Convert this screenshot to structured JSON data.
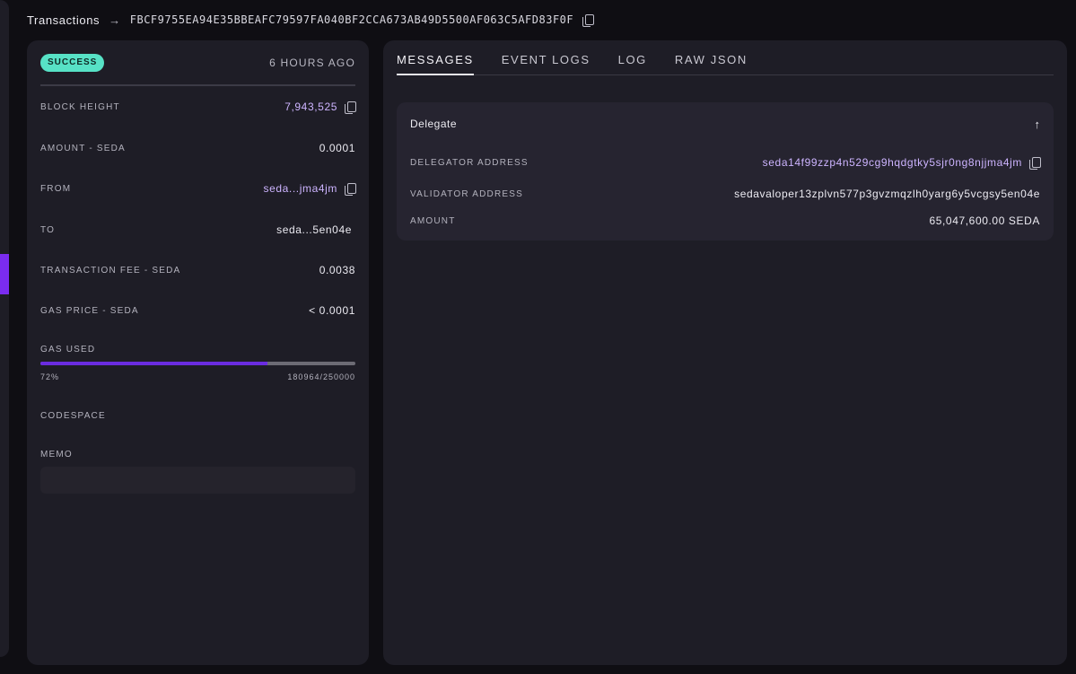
{
  "breadcrumb": {
    "parent": "Transactions",
    "tx_hash": "FBCF9755EA94E35BBEAFC79597FA040BF2CCA673AB49D5500AF063C5AFD83F0F"
  },
  "summary": {
    "status": "SUCCESS",
    "time_ago": "6 HOURS AGO",
    "block_height_label": "BLOCK HEIGHT",
    "block_height": "7,943,525",
    "amount_label": "AMOUNT - SEDA",
    "amount": "0.0001",
    "from_label": "FROM",
    "from": "seda...jma4jm",
    "to_label": "TO",
    "to": "seda...5en04e",
    "fee_label": "TRANSACTION FEE - SEDA",
    "fee": "0.0038",
    "gas_price_label": "GAS PRICE - SEDA",
    "gas_price": "< 0.0001",
    "gas_used_label": "GAS USED",
    "gas_percent": "72%",
    "gas_fraction": 0.72,
    "gas_ratio": "180964/250000",
    "codespace_label": "CODESPACE",
    "memo_label": "MEMO"
  },
  "tabs": [
    {
      "label": "MESSAGES",
      "active": true
    },
    {
      "label": "EVENT LOGS",
      "active": false
    },
    {
      "label": "LOG",
      "active": false
    },
    {
      "label": "RAW JSON",
      "active": false
    }
  ],
  "message": {
    "title": "Delegate",
    "delegator_label": "DELEGATOR ADDRESS",
    "delegator": "seda14f99zzp4n529cg9hqdgtky5sjr0ng8njjma4jm",
    "validator_label": "VALIDATOR ADDRESS",
    "validator": "sedavaloper13zplvn577p3gvzmqzlh0yarg6y5vcgsy5en04e",
    "amount_label": "AMOUNT",
    "amount": "65,047,600.00 SEDA"
  },
  "colors": {
    "accent": "#7b2cf0",
    "success": "#57e2c6",
    "link": "#cdb4ff"
  }
}
